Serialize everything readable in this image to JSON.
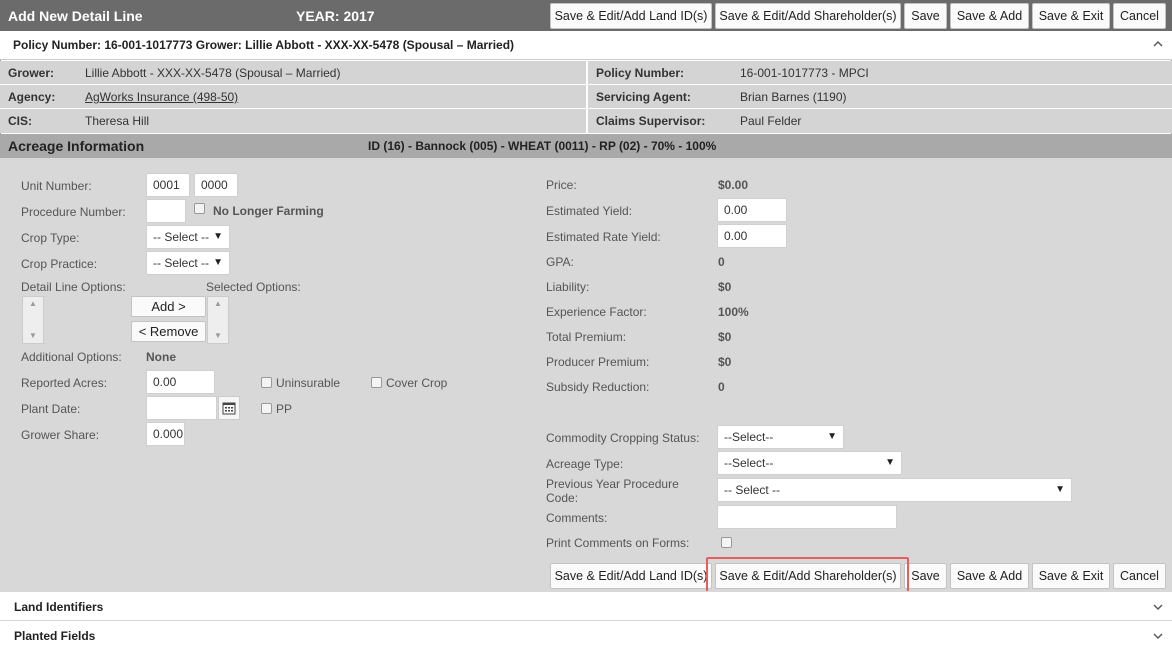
{
  "header": {
    "title": "Add New Detail Line",
    "year": "YEAR: 2017"
  },
  "actions": {
    "land": "Save & Edit/Add Land ID(s)",
    "shareholder": "Save & Edit/Add Shareholder(s)",
    "save": "Save",
    "save_add": "Save & Add",
    "save_exit": "Save & Exit",
    "cancel": "Cancel"
  },
  "policy_bar": "Policy Number: 16-001-1017773 Grower: Lillie Abbott - XXX-XX-5478 (Spousal – Married)",
  "info": {
    "grower_label": "Grower:",
    "grower_value": "Lillie Abbott - XXX-XX-5478 (Spousal – Married)",
    "agency_label": "Agency:",
    "agency_value": "AgWorks Insurance (498-50)",
    "cis_label": "CIS:",
    "cis_value": "Theresa Hill",
    "policy_label": "Policy Number:",
    "policy_value": "16-001-1017773 - MPCI",
    "agent_label": "Servicing Agent:",
    "agent_value": "Brian Barnes (1190)",
    "claims_label": "Claims Supervisor:",
    "claims_value": "Paul Felder"
  },
  "acreage": {
    "title": "Acreage Information",
    "summary": "ID (16) - Bannock (005) - WHEAT (0011) - RP (02) - 70% - 100%"
  },
  "left": {
    "unit_number_label": "Unit Number:",
    "unit_number_1": "0001",
    "unit_number_2": "0000",
    "procedure_label": "Procedure Number:",
    "no_longer_farming": "No Longer Farming",
    "crop_type_label": "Crop Type:",
    "crop_type_value": "-- Select --",
    "crop_practice_label": "Crop Practice:",
    "crop_practice_value": "-- Select --",
    "detail_options_label": "Detail Line Options:",
    "selected_options_label": "Selected Options:",
    "add_button": "Add >",
    "remove_button": "< Remove",
    "additional_options_label": "Additional Options:",
    "additional_options_value": "None",
    "reported_acres_label": "Reported Acres:",
    "reported_acres_value": "0.00",
    "uninsurable": "Uninsurable",
    "cover_crop": "Cover Crop",
    "plant_date_label": "Plant Date:",
    "pp": "PP",
    "grower_share_label": "Grower Share:",
    "grower_share_value": "0.000"
  },
  "right": {
    "price_label": "Price:",
    "price_value": "$0.00",
    "est_yield_label": "Estimated Yield:",
    "est_yield_value": "0.00",
    "est_rate_yield_label": "Estimated Rate Yield:",
    "est_rate_yield_value": "0.00",
    "gpa_label": "GPA:",
    "gpa_value": "0",
    "liability_label": "Liability:",
    "liability_value": "$0",
    "exp_factor_label": "Experience Factor:",
    "exp_factor_value": "100%",
    "total_premium_label": "Total Premium:",
    "total_premium_value": "$0",
    "producer_premium_label": "Producer Premium:",
    "producer_premium_value": "$0",
    "subsidy_label": "Subsidy Reduction:",
    "subsidy_value": "0",
    "commodity_label": "Commodity Cropping Status:",
    "commodity_value": "--Select--",
    "acreage_type_label": "Acreage Type:",
    "acreage_type_value": "--Select--",
    "prev_year_label_1": "Previous Year Procedure",
    "prev_year_label_2": "Code:",
    "prev_year_value": "-- Select --",
    "comments_label": "Comments:",
    "print_comments_label": "Print Comments on Forms:"
  },
  "sections": {
    "land": "Land Identifiers",
    "planted": "Planted Fields"
  }
}
